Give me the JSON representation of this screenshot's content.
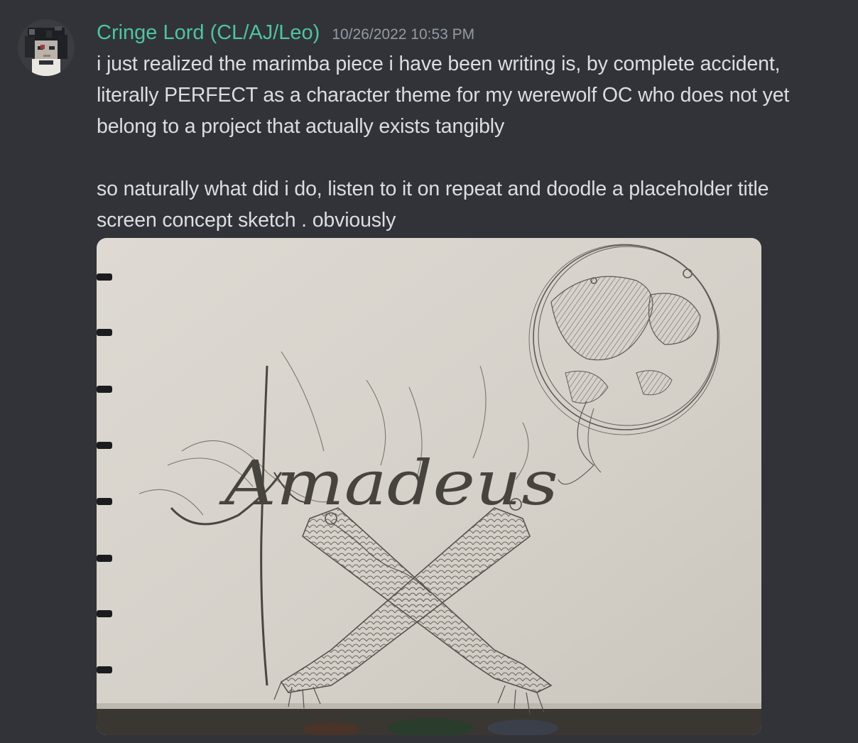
{
  "message": {
    "author": "Cringe Lord (CL/AJ/Leo)",
    "timestamp": "10/26/2022 10:53 PM",
    "lines": [
      "i just realized the marimba piece i have been writing is, by complete accident,",
      "literally PERFECT as a character theme for my werewolf OC who does not yet",
      "belong to a project that actually exists tangibly",
      "",
      "so naturally what did i do, listen to it on repeat and doodle a placeholder title",
      "screen concept sketch . obviously"
    ]
  },
  "attachment": {
    "drawn_text": "Amadeus"
  },
  "colors": {
    "background": "#313338",
    "username": "#4fc4a0",
    "timestamp": "#949ba4",
    "text": "#dbdee1",
    "paper": "#d8d4cc",
    "pencil": "#5a5650"
  }
}
